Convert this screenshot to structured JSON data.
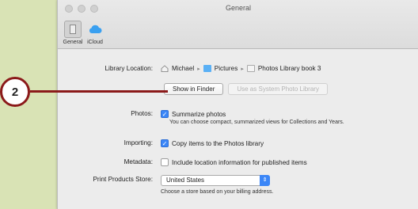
{
  "window": {
    "title": "General"
  },
  "toolbar": {
    "general_label": "General",
    "icloud_label": "iCloud"
  },
  "library": {
    "label": "Library Location:",
    "crumbs": [
      "Michael",
      "Pictures",
      "Photos Library book 3"
    ],
    "show_in_finder": "Show in Finder",
    "use_system_library": "Use as System Photo Library"
  },
  "photos": {
    "label": "Photos:",
    "option": "Summarize photos",
    "checked": true,
    "hint": "You can choose compact, summarized views for Collections and Years."
  },
  "importing": {
    "label": "Importing:",
    "option": "Copy items to the Photos library",
    "checked": true
  },
  "metadata": {
    "label": "Metadata:",
    "option": "Include location information for published items",
    "checked": false
  },
  "print_store": {
    "label": "Print Products Store:",
    "value": "United States",
    "hint": "Choose a store based on your billing address."
  },
  "callout": {
    "number": "2"
  },
  "colors": {
    "background": "#d9e3b5",
    "callout": "#8b1a1a",
    "accent": "#3b86f7"
  }
}
